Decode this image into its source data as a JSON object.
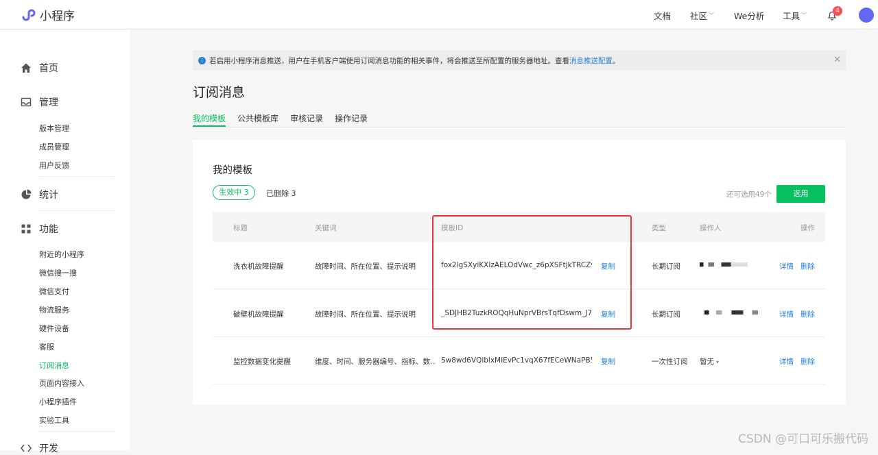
{
  "app": {
    "name": "小程序"
  },
  "topnav": {
    "docs": "文档",
    "community": "社区",
    "we_analysis": "We分析",
    "tools": "工具",
    "notification_count": "4"
  },
  "sidebar": {
    "home": "首页",
    "manage": "管理",
    "manage_items": [
      "版本管理",
      "成员管理",
      "用户反馈"
    ],
    "stats": "统计",
    "features": "功能",
    "feature_items": [
      "附近的小程序",
      "微信搜一搜",
      "微信支付",
      "物流服务",
      "硬件设备",
      "客服",
      "订阅消息",
      "页面内容接入",
      "小程序插件",
      "实验工具"
    ],
    "develop": "开发"
  },
  "notice": {
    "text": "若启用小程序消息推送，用户在手机客户端使用订阅消息功能的相关事件，将会推送至所配置的服务器地址。查看",
    "link": "消息推送配置",
    "end": "。"
  },
  "page": {
    "title": "订阅消息"
  },
  "tabs": [
    "我的模板",
    "公共模板库",
    "审核记录",
    "操作记录"
  ],
  "card": {
    "title": "我的模板",
    "active_filter": "生效中 3",
    "deleted_filter": "已删除 3",
    "remaining": "还可选用49个",
    "select_button": "选用"
  },
  "table": {
    "headers": [
      "标题",
      "关键词",
      "模板ID",
      "类型",
      "操作人",
      "操作"
    ],
    "rows": [
      {
        "title": "洗衣机故障提醒",
        "keywords": "故障时间、所在位置、提示说明",
        "template_id": "fox2lgSXyiKXlzAELOdVwc_z6pXSFtjkTRCZv...",
        "copy": "复制",
        "type": "长期订阅",
        "operator": "",
        "detail": "详情",
        "delete": "删除"
      },
      {
        "title": "破壁机故障提醒",
        "keywords": "故障时间、所在位置、提示说明",
        "template_id": "_SDJHB2TuzkROQqHuNprVBrsTqfDswm_J7...",
        "copy": "复制",
        "type": "长期订阅",
        "operator": "",
        "detail": "详情",
        "delete": "删除"
      },
      {
        "title": "监控数据变化提醒",
        "keywords": "维度、时间、服务器编号、指标、数...",
        "template_id": "Sw8wd6VQiblxMIEvPc1vqX67fECeWNaPB5...",
        "copy": "复制",
        "type": "一次性订阅",
        "operator": "暂无",
        "detail": "详情",
        "delete": "删除"
      }
    ]
  },
  "watermark": "CSDN @可口可乐搬代码"
}
